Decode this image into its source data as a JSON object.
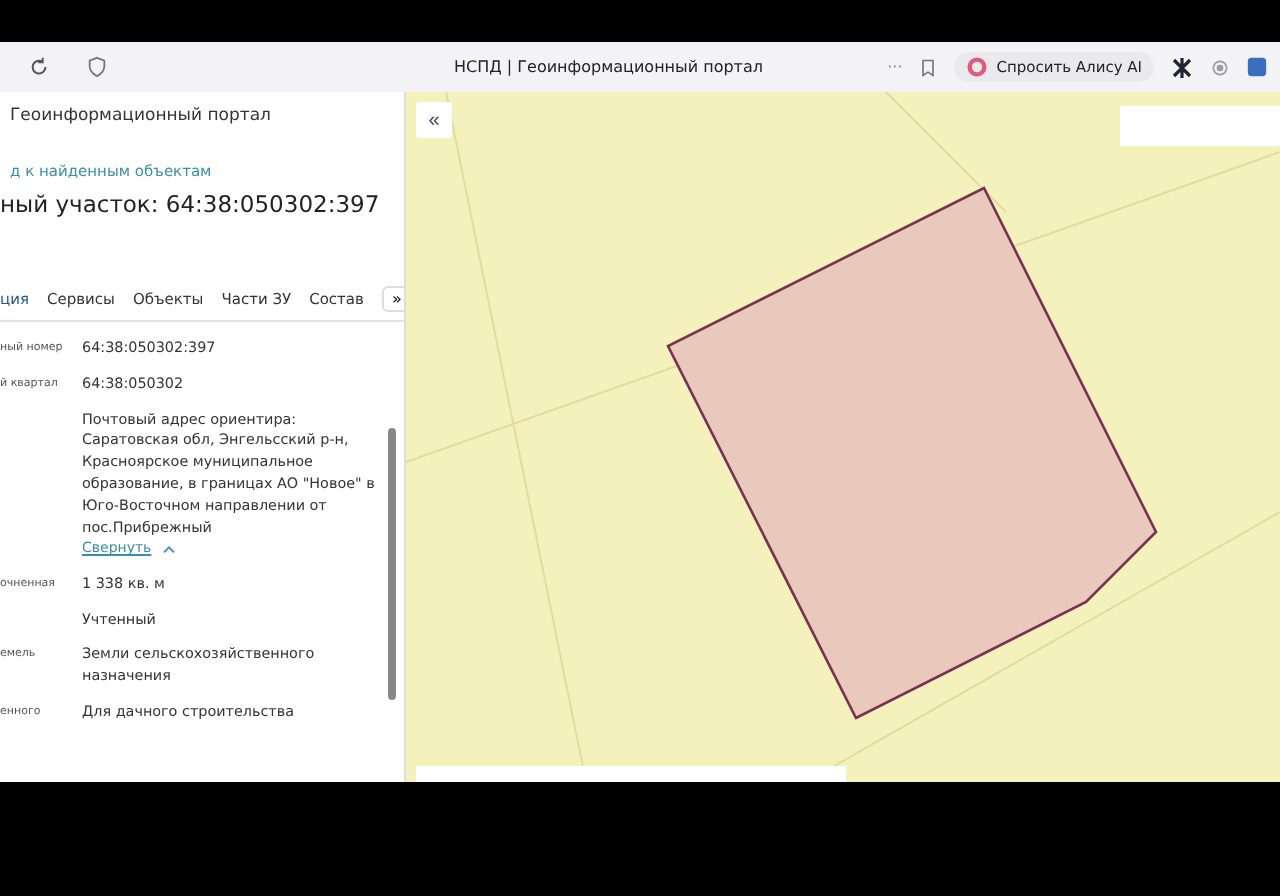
{
  "browser": {
    "page_title": "НСПД | Геоинформационный портал",
    "more": "···",
    "assistant_button": "Спросить Алису AI"
  },
  "panel": {
    "portal_title": "Геоинформационный портал",
    "back_link": "д к найденным объектам",
    "heading": "ный участок: 64:38:050302:397",
    "tabs": [
      {
        "label": "ция",
        "selected": true
      },
      {
        "label": "Сервисы",
        "selected": false
      },
      {
        "label": "Объекты",
        "selected": false
      },
      {
        "label": "Части ЗУ",
        "selected": false
      },
      {
        "label": "Состав",
        "selected": false
      }
    ],
    "tabs_more": "»",
    "rows": [
      {
        "label": "ный номер",
        "value": "64:38:050302:397"
      },
      {
        "label": "й квартал",
        "value": "64:38:050302"
      },
      {
        "value": "Почтовый адрес ориентира: Саратовская обл, Энгельсский р-н, Красноярское муниципальное образование, в границах АО \"Новое\" в Юго-Восточном направлении от пос.Прибрежный",
        "link": "Свернуть"
      },
      {
        "label": "очненная",
        "value": "1 338 кв. м"
      },
      {
        "value": "Учтенный"
      },
      {
        "label": "емель",
        "value": "Земли сельскохозяйственного назначения"
      },
      {
        "label": "енного",
        "value": "Для дачного строительства"
      }
    ]
  },
  "map": {
    "collapse_button": "«"
  }
}
